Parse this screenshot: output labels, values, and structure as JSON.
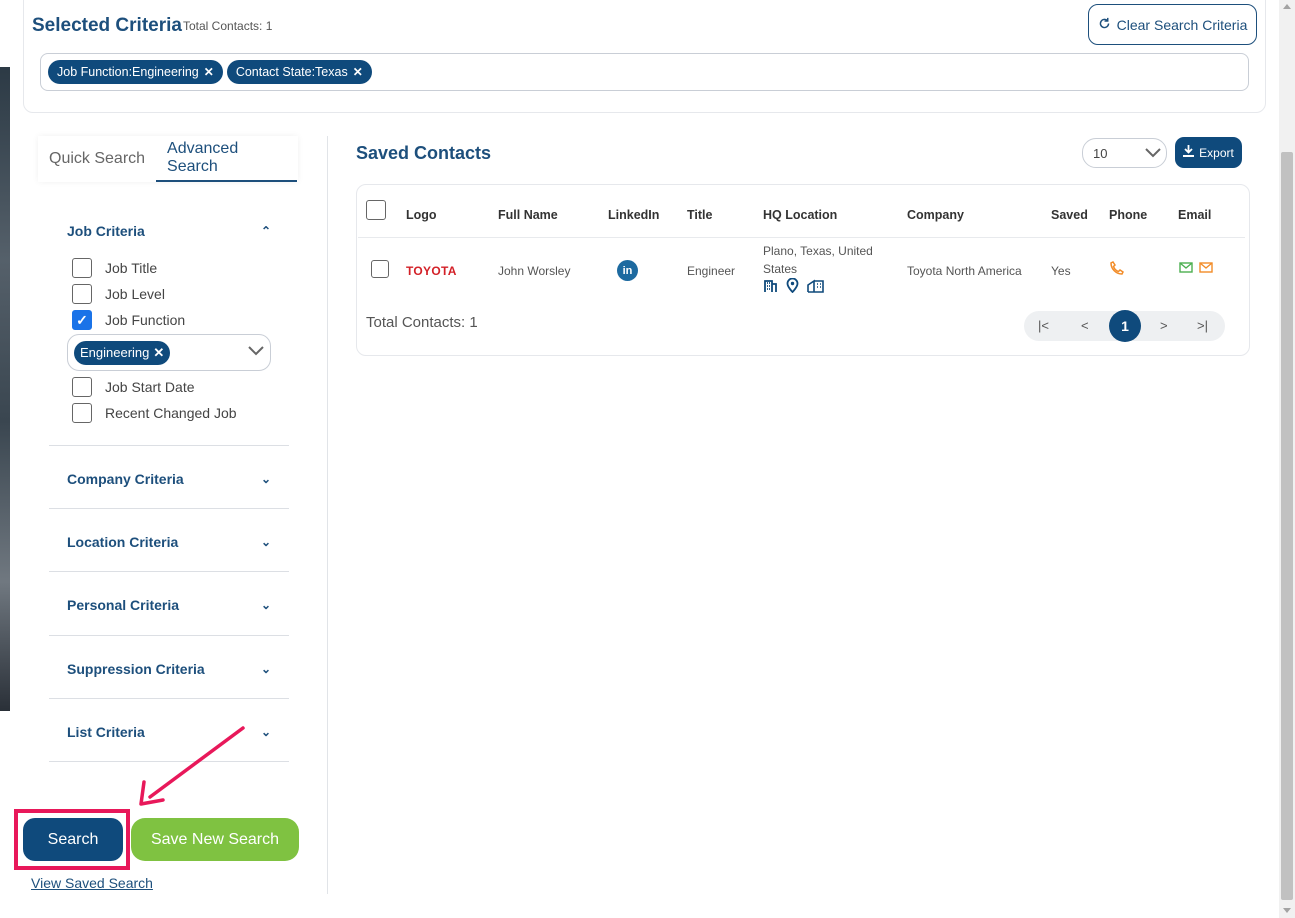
{
  "criteria": {
    "title": "Selected Criteria",
    "total": "Total Contacts: 1",
    "clear_label": "Clear Search Criteria",
    "tags": [
      "Job Function:Engineering",
      "Contact State:Texas"
    ]
  },
  "tabs": [
    "Quick Search",
    "Advanced Search"
  ],
  "job_criteria": {
    "title": "Job Criteria",
    "options": [
      {
        "label": "Job Title",
        "checked": false
      },
      {
        "label": "Job Level",
        "checked": false
      },
      {
        "label": "Job Function",
        "checked": true
      },
      {
        "label": "Job Start Date",
        "checked": false
      },
      {
        "label": "Recent Changed Job",
        "checked": false
      }
    ],
    "job_function_value": "Engineering"
  },
  "sections": [
    "Company Criteria",
    "Location Criteria",
    "Personal Criteria",
    "Suppression Criteria",
    "List Criteria"
  ],
  "actions": {
    "search": "Search",
    "save_new": "Save New Search",
    "view_saved": "View Saved Search"
  },
  "results": {
    "title": "Saved Contacts",
    "per_page": "10",
    "export": "Export",
    "columns": [
      "Logo",
      "Full Name",
      "LinkedIn",
      "Title",
      "HQ Location",
      "Company",
      "Saved",
      "Phone",
      "Email"
    ],
    "row": {
      "logo": "TOYOTA",
      "full_name": "John Worsley",
      "linkedin": "in",
      "title": "Engineer",
      "hq_line1": "Plano, Texas, United",
      "hq_line2": "States",
      "company": "Toyota North America",
      "saved": "Yes"
    },
    "total": "Total Contacts: 1",
    "pager": {
      "first": "|<",
      "prev": "<",
      "current": "1",
      "next": ">",
      "last": ">|"
    }
  },
  "colors": {
    "primary": "#0f4a7c",
    "accent_green": "#7fc241",
    "highlight": "#e8185a"
  }
}
